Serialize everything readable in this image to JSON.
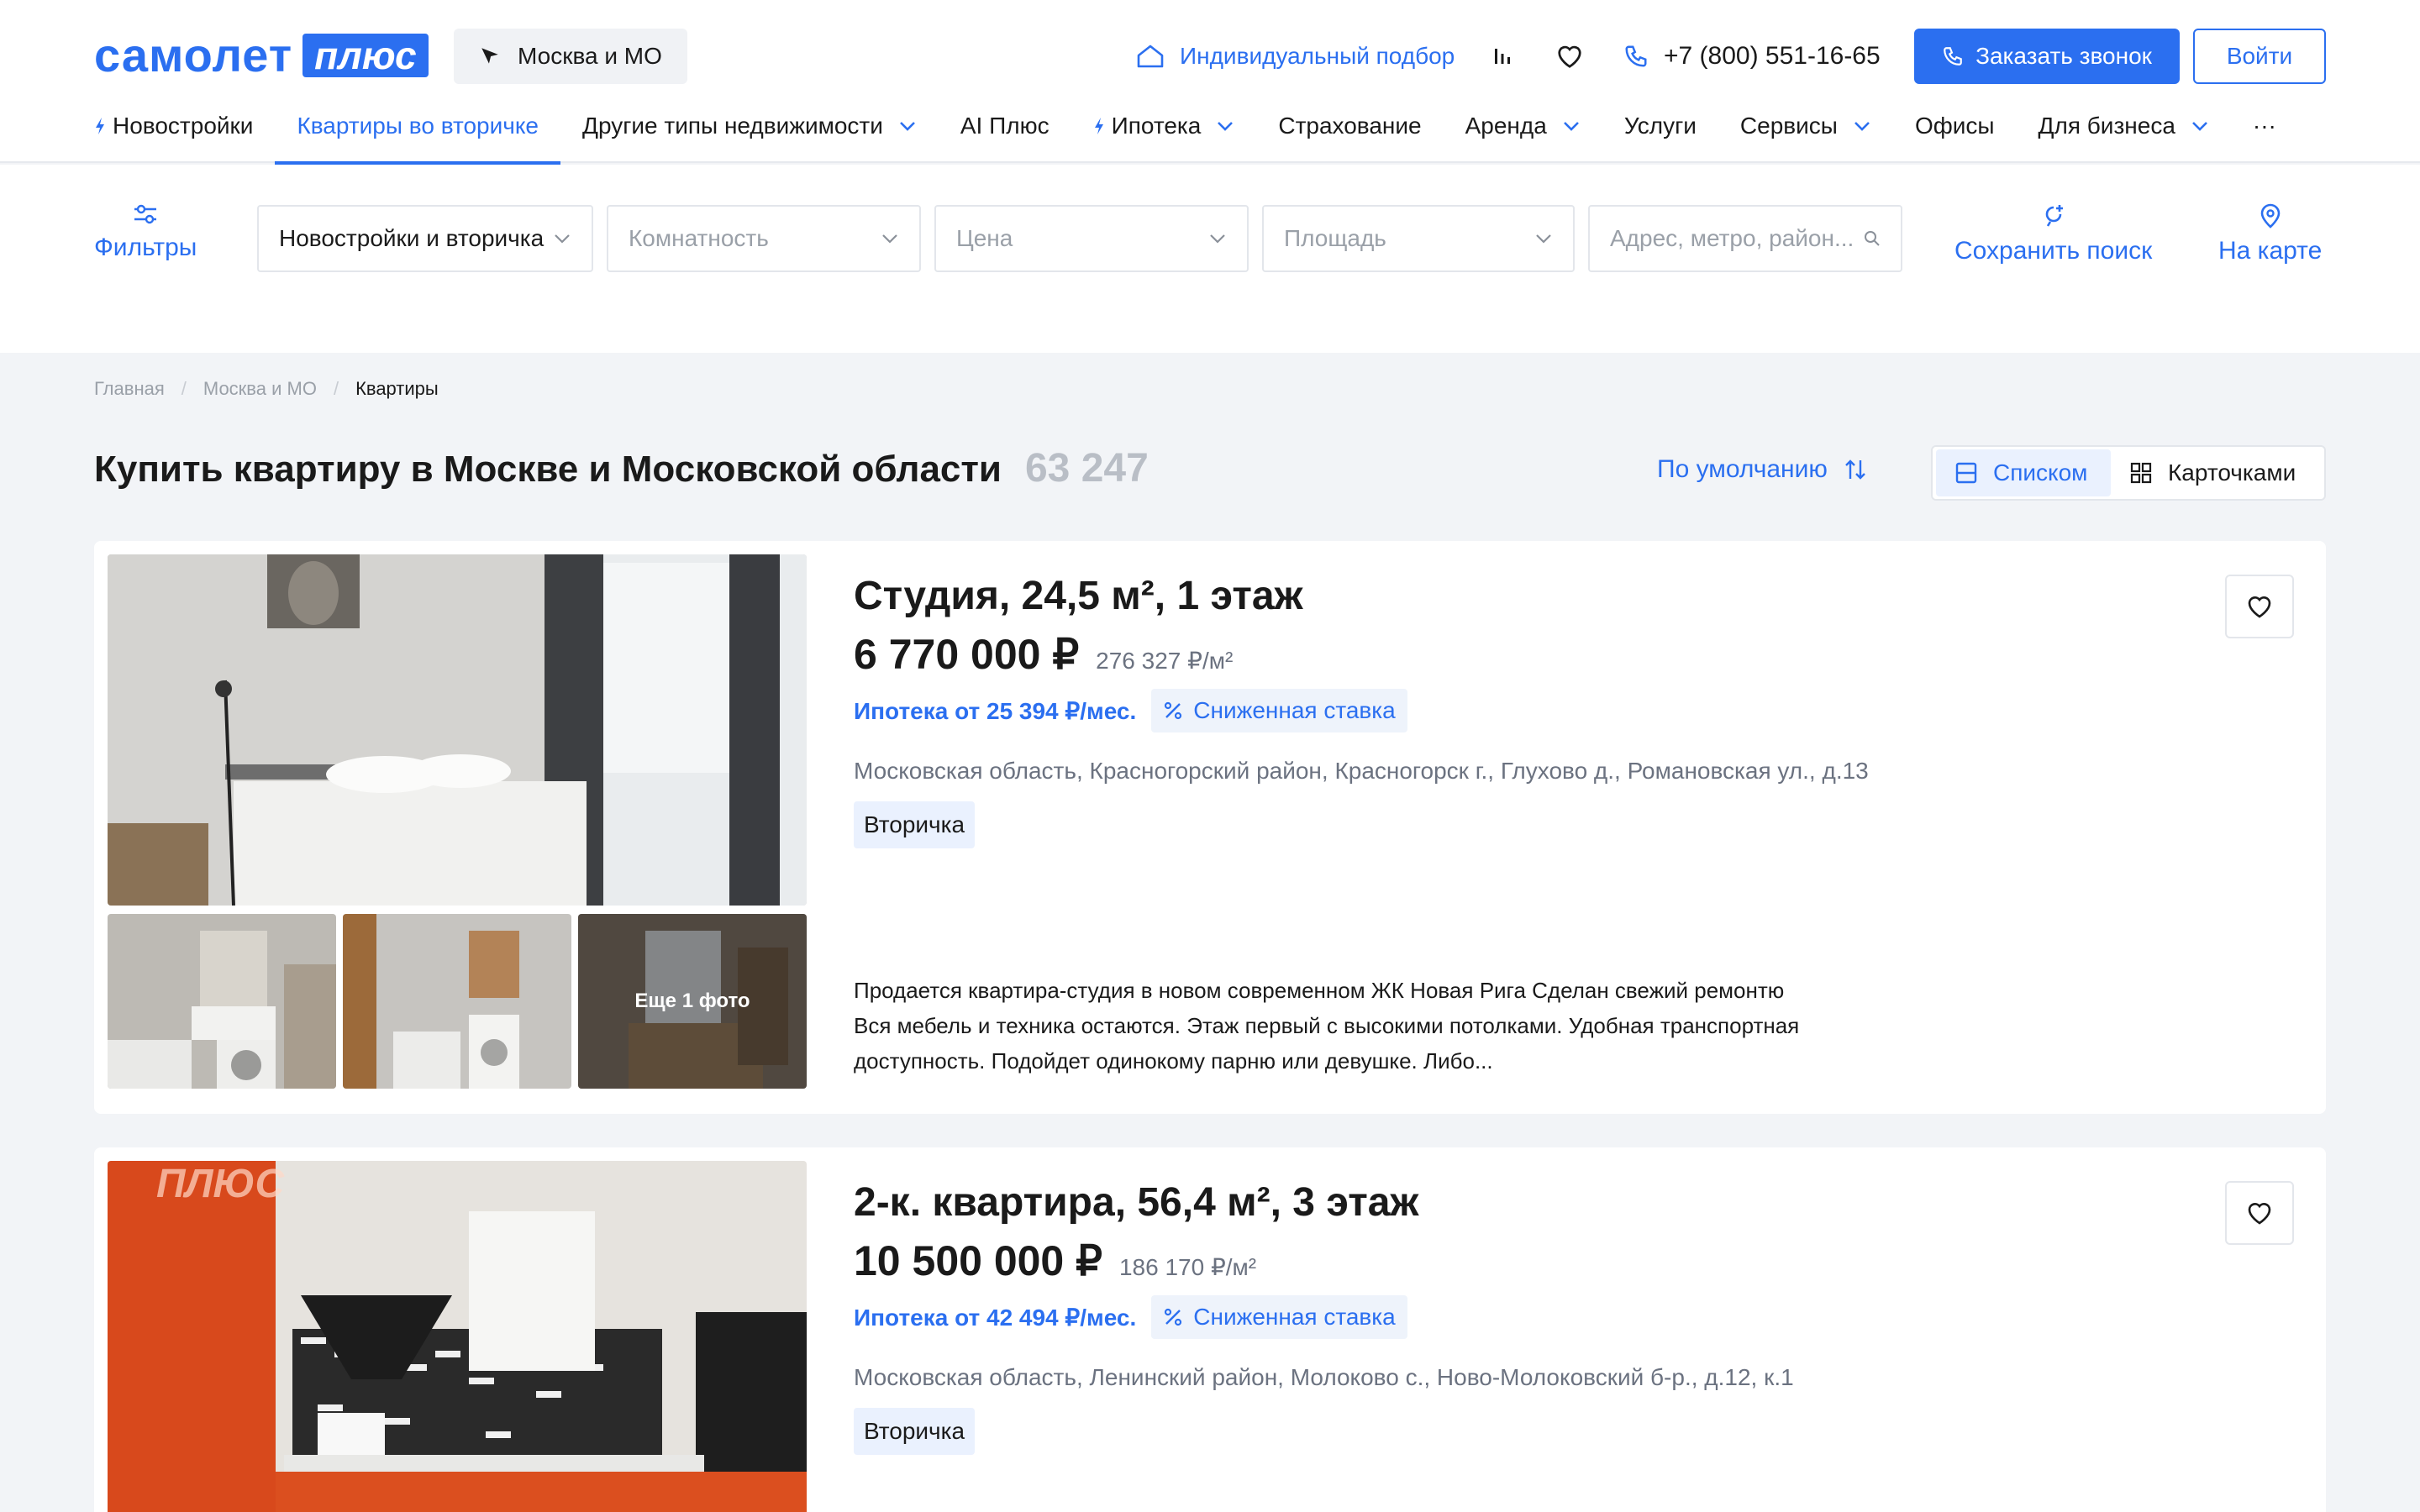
{
  "header": {
    "logo_word": "самолет",
    "logo_plus": "плюс",
    "region": "Москва и МО",
    "individual": "Индивидуальный подбор",
    "phone": "+7 (800) 551-16-65",
    "call_button": "Заказать звонок",
    "login_button": "Войти"
  },
  "nav": {
    "items": [
      {
        "label": "Новостройки"
      },
      {
        "label": "Квартиры во вторичке"
      },
      {
        "label": "Другие типы недвижимости"
      },
      {
        "label": "AI Плюс"
      },
      {
        "label": "Ипотека"
      },
      {
        "label": "Страхование"
      },
      {
        "label": "Аренда"
      },
      {
        "label": "Услуги"
      },
      {
        "label": "Сервисы"
      },
      {
        "label": "Офисы"
      },
      {
        "label": "Для бизнеса"
      }
    ],
    "more": "···"
  },
  "filters": {
    "filters_label": "Фильтры",
    "type_value": "Новостройки и вторичка",
    "rooms_placeholder": "Комнатность",
    "price_placeholder": "Цена",
    "area_placeholder": "Площадь",
    "address_placeholder": "Адрес, метро, район...",
    "save_search": "Сохранить поиск",
    "on_map": "На карте"
  },
  "breadcrumb": [
    "Главная",
    "Москва и МО",
    "Квартиры"
  ],
  "page": {
    "title": "Купить квартиру в Москве и Московской области",
    "count": "63 247",
    "sort_label": "По умолчанию",
    "view_list": "Списком",
    "view_cards": "Карточками"
  },
  "listings": [
    {
      "title": "Студия, 24,5 м², 1 этаж",
      "price": "6 770 000 ₽",
      "price_per_m2": "276 327 ₽/м²",
      "mortgage": "Ипотека от 25 394 ₽/мес.",
      "rate_badge": "Сниженная ставка",
      "address": "Московская область, Красногорский район, Красногорск г., Глухово д., Романовская ул., д.13",
      "tag": "Вторичка",
      "more_photos": "Еще 1 фото",
      "description": "Продается квартира-студия в новом современном ЖК Новая Рига Сделан свежий ремонтю Вся мебель и техника остаются. Этаж первый с высокими потолками. Удобная транспортная доступность. Подойдет одинокому парню или девушке. Либо..."
    },
    {
      "title": "2-к. квартира, 56,4 м², 3 этаж",
      "price": "10 500 000 ₽",
      "price_per_m2": "186 170 ₽/м²",
      "mortgage": "Ипотека от 42 494 ₽/мес.",
      "rate_badge": "Сниженная ставка",
      "address": "Московская область, Ленинский район, Молоково с., Ново-Молоковский б-р., д.12, к.1",
      "tag": "Вторичка",
      "watermark": "ПЛЮС"
    }
  ],
  "colors": {
    "accent": "#2b6ff0",
    "background": "#f2f4f7",
    "muted": "#6b7280"
  }
}
